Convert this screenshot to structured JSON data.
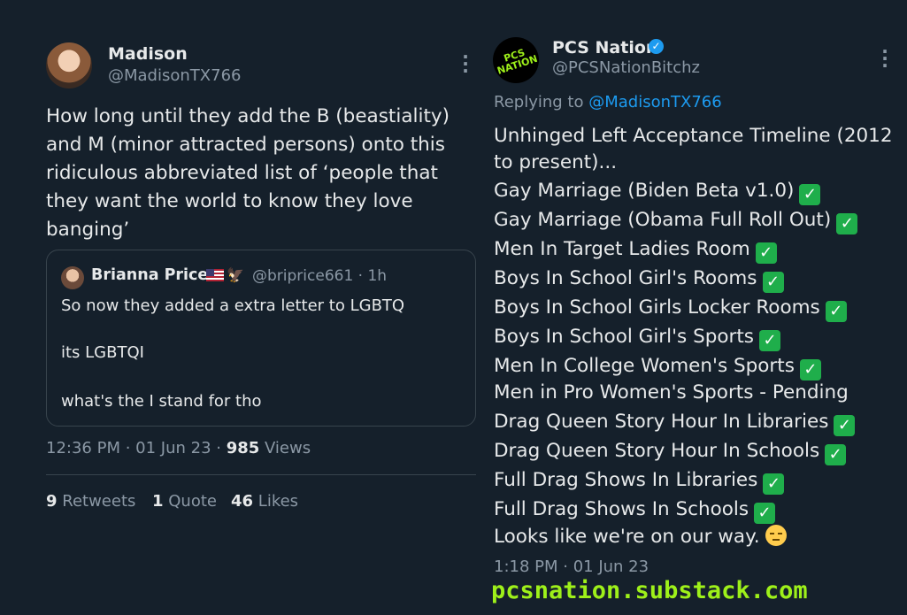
{
  "left_tweet": {
    "name": "Madison",
    "handle": "@MadisonTX766",
    "text_lines": [
      "How long until they add the B (beastiality)",
      "and M (minor attracted persons) onto this",
      "ridiculous abbreviated list of ‘people that",
      "they want the world to know they love",
      "banging’"
    ],
    "quote": {
      "name": "Brianna Price",
      "handle_time": "@briprice661 · 1h",
      "line1": "So now they added a extra letter to LGBTQ",
      "line2": "its LGBTQI",
      "line3": "what's the I stand for tho"
    },
    "meta": {
      "time_date": "12:36 PM · 01 Jun 23 · ",
      "views_count": "985",
      "views_label": " Views"
    },
    "stats": {
      "retweets_count": "9",
      "retweets_label": " Retweets",
      "quotes_count": "1",
      "quotes_label": " Quote",
      "likes_count": "46",
      "likes_label": " Likes"
    }
  },
  "right_tweet": {
    "name": "PCS Nation",
    "handle": "@PCSNationBitchz",
    "avatar_text": "PCS NATION",
    "replying_prefix": "Replying to ",
    "replying_mention": "@MadisonTX766",
    "lines": [
      {
        "text": "Unhinged Left Acceptance Timeline (2012",
        "check": false
      },
      {
        "text": "to present)...",
        "check": false
      },
      {
        "text": "Gay Marriage (Biden Beta v1.0)",
        "check": true
      },
      {
        "text": "Gay Marriage (Obama Full Roll Out)",
        "check": true
      },
      {
        "text": "Men In Target Ladies Room",
        "check": true
      },
      {
        "text": "Boys In School Girl's Rooms",
        "check": true
      },
      {
        "text": "Boys In School Girls Locker Rooms",
        "check": true
      },
      {
        "text": "Boys In School Girl's Sports",
        "check": true
      },
      {
        "text": "Men In College Women's Sports",
        "check": true
      },
      {
        "text": "Men in Pro Women's Sports - Pending",
        "check": false
      },
      {
        "text": "Drag Queen Story Hour In Libraries",
        "check": true
      },
      {
        "text": "Drag Queen Story Hour In Schools",
        "check": true
      },
      {
        "text": "Full Drag Shows In Libraries",
        "check": true
      },
      {
        "text": "Full Drag Shows In Schools",
        "check": true
      },
      {
        "text": "Looks like we're on our way.",
        "check": false,
        "face": true
      }
    ],
    "time_date": "1:18 PM · 01 Jun 23"
  },
  "watermark": "pcsnation.substack.com",
  "colors": {
    "background": "#15202b",
    "text": "#e7e9ea",
    "muted": "#8b98a5",
    "link": "#1d9bf0",
    "check": "#1fae4b",
    "watermark": "#9ef01a"
  },
  "icons": [
    "more-options-icon",
    "verified-badge-icon",
    "check-mark-icon",
    "expressionless-face-icon",
    "us-flag-icon",
    "eagle-icon"
  ]
}
